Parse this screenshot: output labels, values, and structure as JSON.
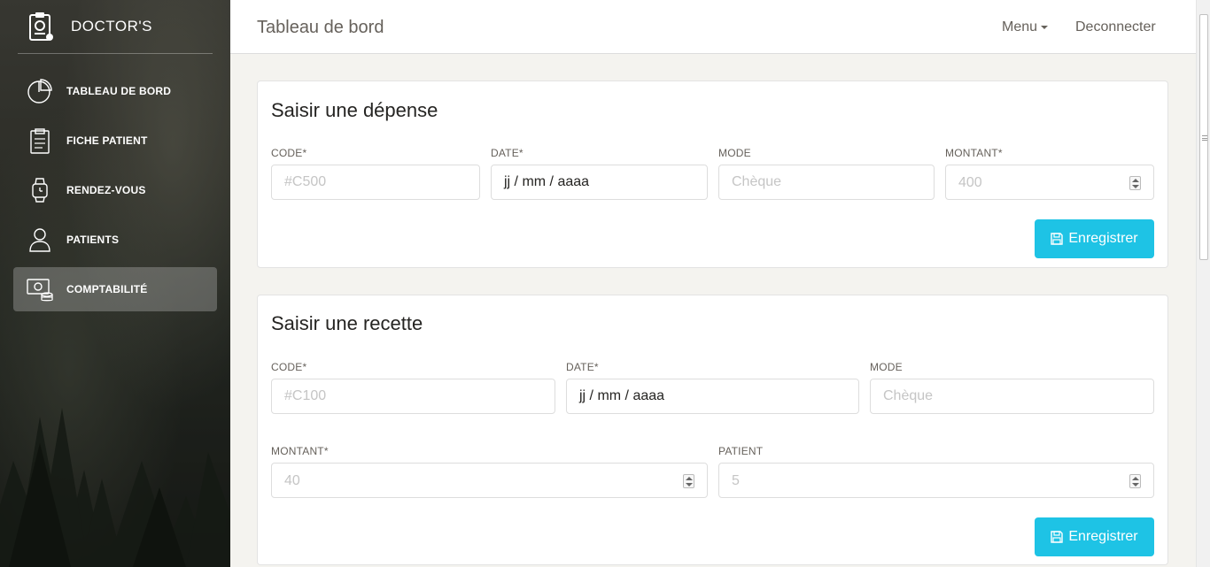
{
  "sidebar": {
    "brand": "DOCTOR'S",
    "items": [
      {
        "label": "TABLEAU DE BORD",
        "icon": "pie-chart-icon"
      },
      {
        "label": "FICHE PATIENT",
        "icon": "clipboard-icon"
      },
      {
        "label": "RENDEZ-VOUS",
        "icon": "watch-icon"
      },
      {
        "label": "PATIENTS",
        "icon": "user-icon"
      },
      {
        "label": "COMPTABILITÉ",
        "icon": "money-icon",
        "active": true
      }
    ]
  },
  "topbar": {
    "title": "Tableau de bord",
    "menu": "Menu",
    "logout": "Deconnecter"
  },
  "depense": {
    "title": "Saisir une dépense",
    "code_label": "CODE*",
    "code_placeholder": "#C500",
    "date_label": "DATE*",
    "date_value": "jj / mm / aaaa",
    "mode_label": "MODE",
    "mode_placeholder": "Chèque",
    "montant_label": "MONTANT*",
    "montant_placeholder": "400",
    "save_label": "Enregistrer"
  },
  "recette": {
    "title": "Saisir une recette",
    "code_label": "CODE*",
    "code_placeholder": "#C100",
    "date_label": "DATE*",
    "date_value": "jj / mm / aaaa",
    "mode_label": "MODE",
    "mode_placeholder": "Chèque",
    "montant_label": "MONTANT*",
    "montant_placeholder": "40",
    "patient_label": "PATIENT",
    "patient_placeholder": "5",
    "save_label": "Enregistrer"
  },
  "colors": {
    "accent": "#1ec3e5",
    "active_nav": "rgba(200,200,200,0.32)"
  }
}
